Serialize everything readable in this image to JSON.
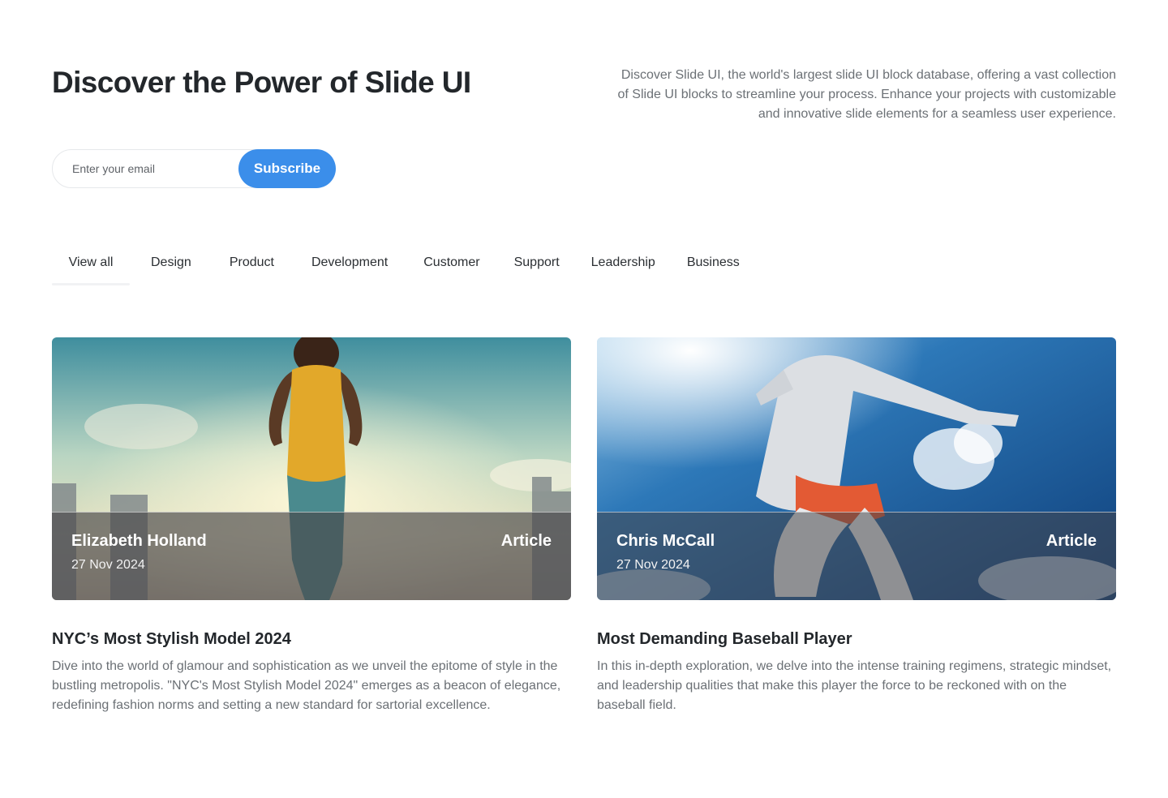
{
  "hero": {
    "title": "Discover the Power of Slide UI",
    "description": "Discover Slide UI, the world's largest slide UI block database, offering a vast collection of Slide UI blocks to streamline your process. Enhance your projects with customizable and innovative slide elements for a seamless user experience."
  },
  "subscribe": {
    "placeholder": "Enter your email",
    "button_label": "Subscribe"
  },
  "tabs": [
    {
      "label": "View all",
      "active": true
    },
    {
      "label": "Design"
    },
    {
      "label": "Product"
    },
    {
      "label": "Development"
    },
    {
      "label": "Customer"
    },
    {
      "label": "Support"
    },
    {
      "label": "Leadership"
    },
    {
      "label": "Business"
    }
  ],
  "colors": {
    "accent": "#3b8eea",
    "heading": "#23272b",
    "body_text": "#6b7075"
  },
  "cards": [
    {
      "author": "Elizabeth Holland",
      "date": "27 Nov 2024",
      "type": "Article",
      "title": "NYC’s Most Stylish Model 2024",
      "excerpt": "Dive into the world of glamour and sophistication as we unveil the epitome of style in the bustling metropolis. \"NYC's Most Stylish Model 2024\" emerges as a beacon of elegance, redefining fashion norms and setting a new standard for sartorial excellence.",
      "image": "runner-city-sunset-photo"
    },
    {
      "author": "Chris McCall",
      "date": "27 Nov 2024",
      "type": "Article",
      "title": "Most Demanding Baseball Player",
      "excerpt": "In this in-depth exploration, we delve into the intense training regimens, strategic mindset, and leadership qualities that make this player the force to be reckoned with on the baseball field.",
      "image": "runner-blue-sky-photo"
    }
  ]
}
